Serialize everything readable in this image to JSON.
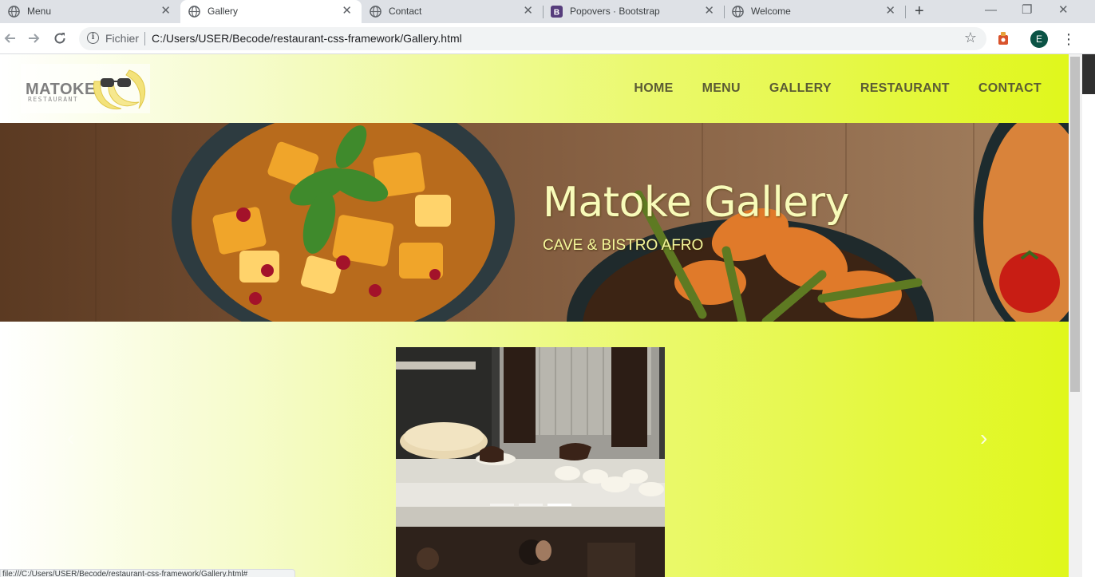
{
  "browser": {
    "tabs": [
      {
        "title": "Menu",
        "icon": "globe-icon",
        "active": false
      },
      {
        "title": "Gallery",
        "icon": "globe-icon",
        "active": true
      },
      {
        "title": "Contact",
        "icon": "globe-icon",
        "active": false
      },
      {
        "title": "Popovers · Bootstrap",
        "icon": "bootstrap-icon",
        "active": false
      },
      {
        "title": "Welcome",
        "icon": "globe-icon",
        "active": false
      }
    ],
    "new_tab_glyph": "+",
    "close_glyph": "✕",
    "window_controls": {
      "minimize": "—",
      "restore": "❐",
      "close": "✕"
    },
    "address_bar": {
      "scheme_label": "Fichier",
      "url": "C:/Users/USER/Becode/restaurant-css-framework/Gallery.html"
    },
    "profile_initial": "E",
    "status_url": "file:///C:/Users/USER/Becode/restaurant-css-framework/Gallery.html#"
  },
  "site": {
    "logo": {
      "wordmark": "MATOKE",
      "sub": "RESTAURANT"
    },
    "nav": [
      {
        "label": "HOME"
      },
      {
        "label": "MENU"
      },
      {
        "label": "GALLERY"
      },
      {
        "label": "RESTAURANT"
      },
      {
        "label": "CONTACT"
      }
    ],
    "hero": {
      "title": "Matoke Gallery",
      "subtitle": "CAVE & BISTRO AFRO"
    },
    "carousel": {
      "prev_glyph": "‹",
      "next_glyph": "›",
      "indicators": [
        {
          "active": false
        },
        {
          "active": false
        },
        {
          "active": true
        }
      ]
    }
  },
  "colors": {
    "gradient_start": "#ffffff",
    "gradient_end": "#e0f71c",
    "nav_text": "#5b5b34",
    "hero_text": "#f8fbb9"
  }
}
